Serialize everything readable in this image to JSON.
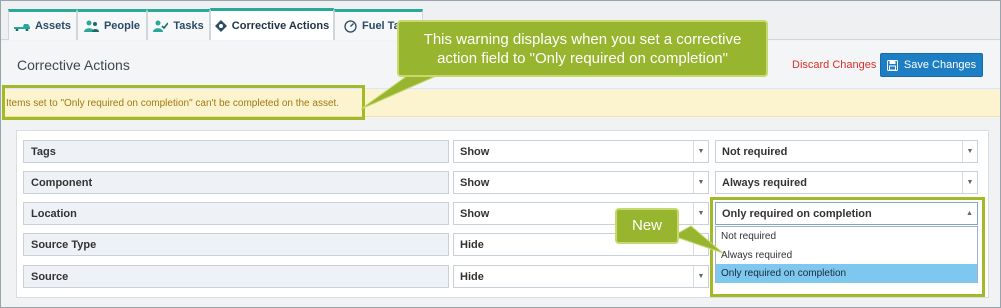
{
  "tabs": [
    {
      "label": "Assets",
      "icon": "truck-icon"
    },
    {
      "label": "People",
      "icon": "people-icon"
    },
    {
      "label": "Tasks",
      "icon": "tasks-icon"
    },
    {
      "label": "Corrective Actions",
      "icon": "wrench-icon",
      "active": true
    },
    {
      "label": "Fuel Tabl",
      "icon": "gauge-icon"
    }
  ],
  "header": {
    "title": "Corrective Actions",
    "discard_label": "Discard Changes",
    "save_label": "Save Changes"
  },
  "warning": {
    "text": "Items set to \"Only required on completion\" can't be completed on the asset."
  },
  "callouts": {
    "warning_note_line1": "This warning displays when you set a corrective",
    "warning_note_line2": "action field to \"Only required on completion\"",
    "new_note": "New"
  },
  "fields": [
    {
      "label": "Tags",
      "visibility": "Show",
      "requirement": "Not required"
    },
    {
      "label": "Component",
      "visibility": "Show",
      "requirement": "Always required"
    },
    {
      "label": "Location",
      "visibility": "Show",
      "requirement": "Only required on completion"
    },
    {
      "label": "Source Type",
      "visibility": "Hide",
      "requirement": ""
    },
    {
      "label": "Source",
      "visibility": "Hide",
      "requirement": ""
    }
  ],
  "requirement_options": [
    {
      "label": "Not required",
      "selected": false
    },
    {
      "label": "Always required",
      "selected": false
    },
    {
      "label": "Only required on completion",
      "selected": true
    }
  ],
  "colors": {
    "accent": "#1d7ec4",
    "discard": "#d9302c",
    "warning_bg": "#fcf3cf",
    "highlight": "#a4b928",
    "selected_option": "#7ec8f0"
  }
}
